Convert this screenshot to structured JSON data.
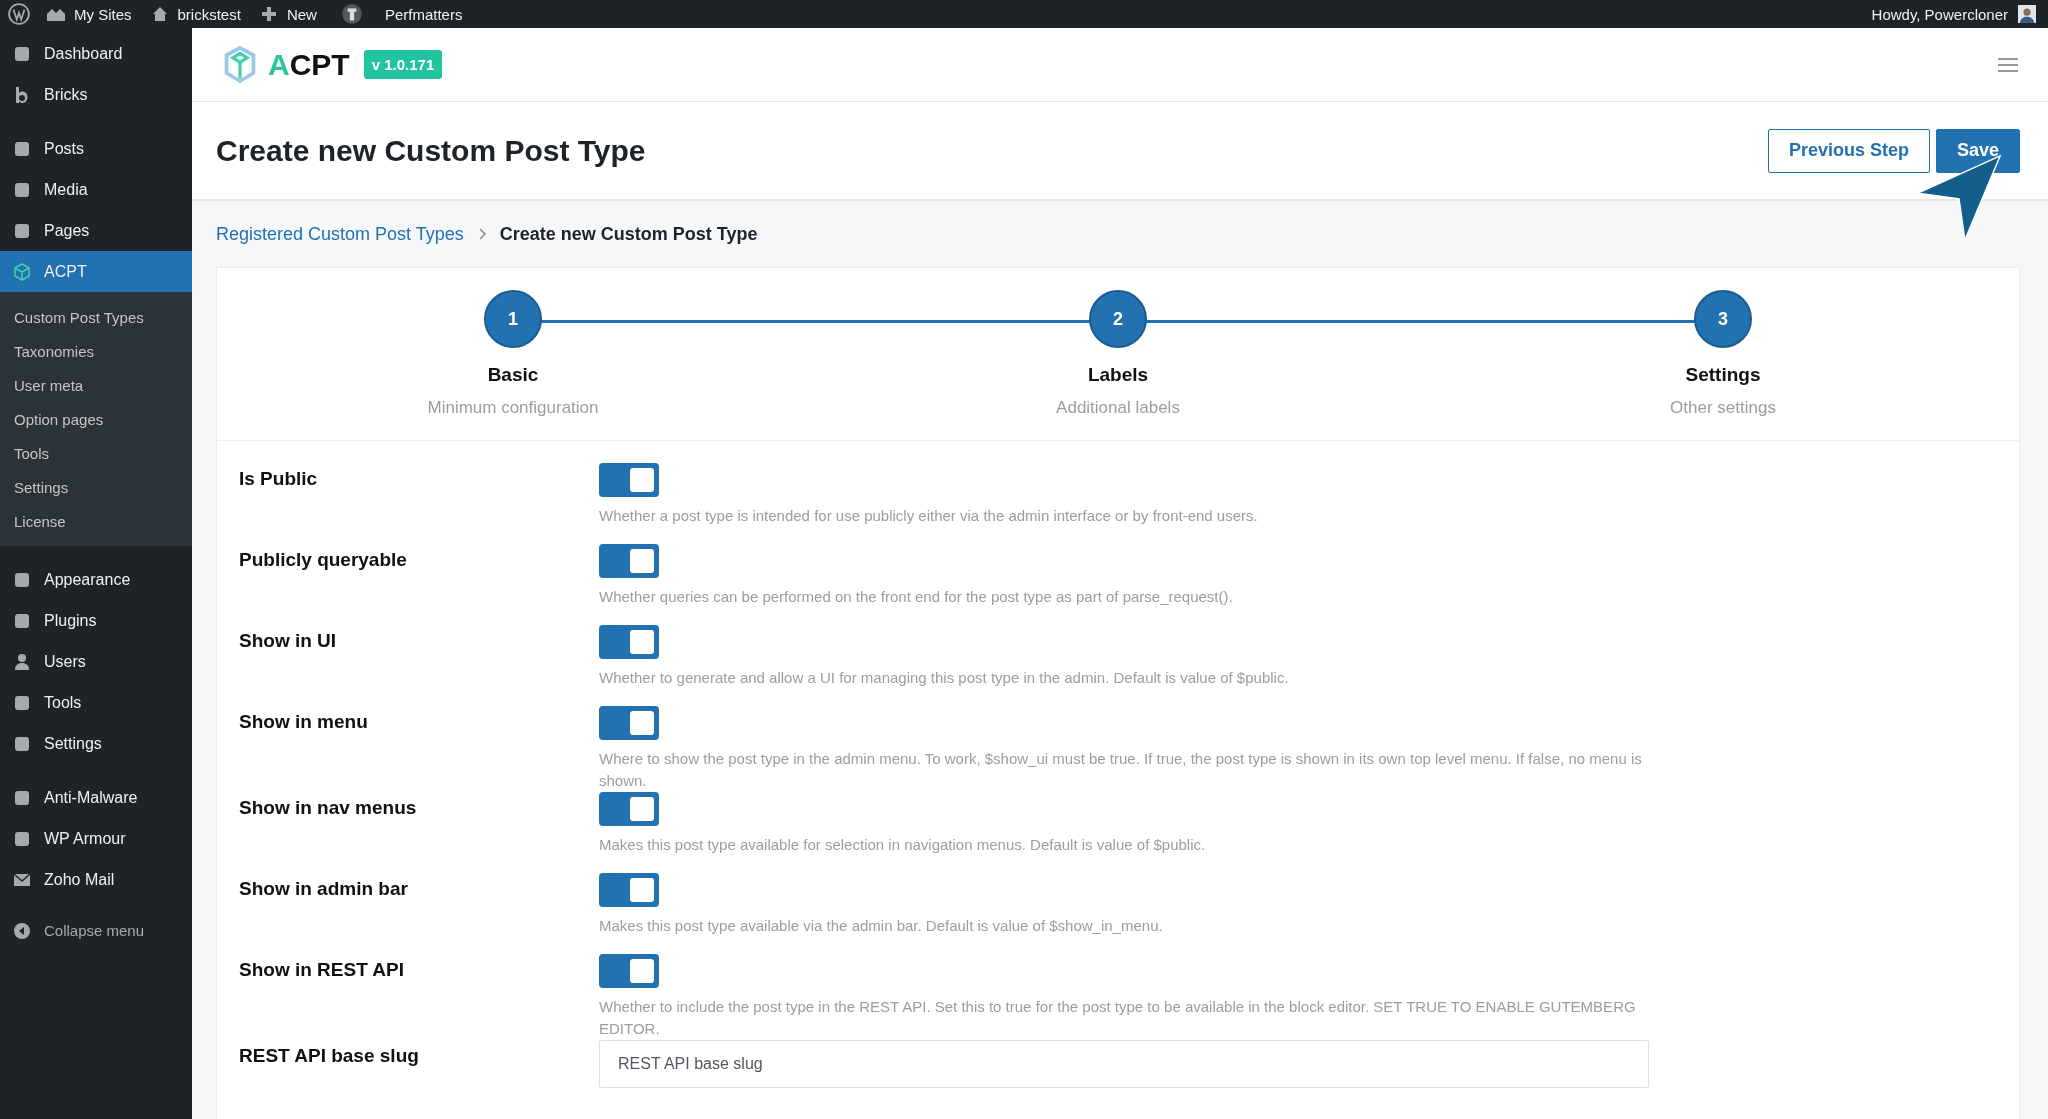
{
  "admin_bar": {
    "left": [
      "My Sites",
      "brickstest",
      "New",
      "Perfmatters"
    ],
    "greeting": "Howdy, Powercloner"
  },
  "sidebar": {
    "groups": [
      {
        "items": [
          {
            "label": "Dashboard",
            "selected": false
          },
          {
            "label": "Bricks",
            "selected": false
          }
        ]
      },
      {
        "items": [
          {
            "label": "Posts",
            "selected": false
          },
          {
            "label": "Media",
            "selected": false
          },
          {
            "label": "Pages",
            "selected": false
          },
          {
            "label": "ACPT",
            "selected": true
          }
        ],
        "submenu": [
          {
            "label": "Custom Post Types",
            "selected": false
          },
          {
            "label": "Taxonomies",
            "selected": false
          },
          {
            "label": "User meta",
            "selected": false
          },
          {
            "label": "Option pages",
            "selected": false
          },
          {
            "label": "Tools",
            "selected": false
          },
          {
            "label": "Settings",
            "selected": false
          },
          {
            "label": "License",
            "selected": false
          }
        ]
      },
      {
        "items": [
          {
            "label": "Appearance",
            "selected": false
          },
          {
            "label": "Plugins",
            "selected": false
          },
          {
            "label": "Users",
            "selected": false
          },
          {
            "label": "Tools",
            "selected": false
          },
          {
            "label": "Settings",
            "selected": false
          }
        ]
      },
      {
        "items": [
          {
            "label": "Anti-Malware",
            "selected": false
          },
          {
            "label": "WP Armour",
            "selected": false
          },
          {
            "label": "Zoho Mail",
            "selected": false
          }
        ]
      }
    ],
    "collapse": "Collapse menu"
  },
  "plugin_header": {
    "logo_first": "A",
    "logo_rest": "CPT",
    "version": "v 1.0.171"
  },
  "page": {
    "title": "Create new Custom Post Type",
    "buttons": [
      {
        "label": "Previous Step",
        "kind": "outline"
      },
      {
        "label": "Save",
        "kind": "primary"
      }
    ]
  },
  "breadcrumb": [
    {
      "label": "Registered Custom Post Types",
      "kind": "link"
    },
    {
      "label": "Create new Custom Post Type",
      "kind": "current"
    }
  ],
  "steps": [
    {
      "number": "1",
      "title": "Basic",
      "subtitle": "Minimum configuration"
    },
    {
      "number": "2",
      "title": "Labels",
      "subtitle": "Additional labels"
    },
    {
      "number": "3",
      "title": "Settings",
      "subtitle": "Other settings"
    }
  ],
  "fields": [
    {
      "kind": "toggle",
      "label": "Is Public",
      "on": true,
      "description": "Whether a post type is intended for use publicly either via the admin interface or by front-end users."
    },
    {
      "kind": "toggle",
      "label": "Publicly queryable",
      "on": true,
      "description": "Whether queries can be performed on the front end for the post type as part of parse_request()."
    },
    {
      "kind": "toggle",
      "label": "Show in UI",
      "on": true,
      "description": "Whether to generate and allow a UI for managing this post type in the admin. Default is value of $public."
    },
    {
      "kind": "toggle",
      "label": "Show in menu",
      "on": true,
      "description": "Where to show the post type in the admin menu. To work, $show_ui must be true. If true, the post type is shown in its own top level menu. If false, no menu is shown."
    },
    {
      "kind": "toggle",
      "label": "Show in nav menus",
      "on": true,
      "description": "Makes this post type available for selection in navigation menus. Default is value of $public."
    },
    {
      "kind": "toggle",
      "label": "Show in admin bar",
      "on": true,
      "description": "Makes this post type available via the admin bar. Default is value of $show_in_menu."
    },
    {
      "kind": "toggle",
      "label": "Show in REST API",
      "on": true,
      "description": "Whether to include the post type in the REST API. Set this to true for the post type to be available in the block editor. SET TRUE TO ENABLE GUTEMBERG EDITOR."
    },
    {
      "kind": "text",
      "label": "REST API base slug",
      "placeholder": "REST API base slug"
    }
  ]
}
